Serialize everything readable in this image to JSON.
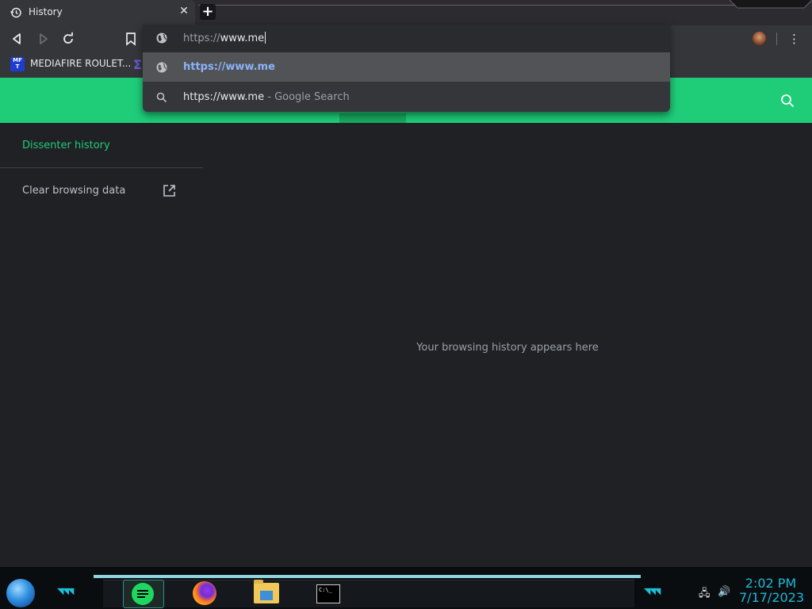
{
  "tab": {
    "title": "History",
    "close": "✕",
    "new_tab": "+"
  },
  "toolbar": {
    "menu": "⋮"
  },
  "omnibox": {
    "scheme": "https://",
    "host": "www.me",
    "suggestions": [
      {
        "type": "url",
        "text": "https://www.me"
      },
      {
        "type": "search",
        "query": "https://www.me",
        "suffix": " - Google Search"
      }
    ]
  },
  "bookmarks": [
    {
      "icon_text": "MF T",
      "label": "MEDIAFIRE ROULET..."
    },
    {
      "icon_text": "Σ",
      "label": ""
    }
  ],
  "sidebar": {
    "title": "Dissenter history",
    "clear": "Clear browsing data"
  },
  "main": {
    "empty_message": "Your browsing history appears here"
  },
  "taskbar": {
    "time": "2:02 PM",
    "date": "7/17/2023",
    "apps": [
      "spotify-like",
      "firefox",
      "file-explorer",
      "terminal"
    ],
    "terminal_text": "C:\\_"
  },
  "colors": {
    "accent": "#1fcd79",
    "background": "#202124",
    "chrome": "#35363a",
    "link": "#8ab4f8",
    "clock": "#1fb8d6"
  }
}
